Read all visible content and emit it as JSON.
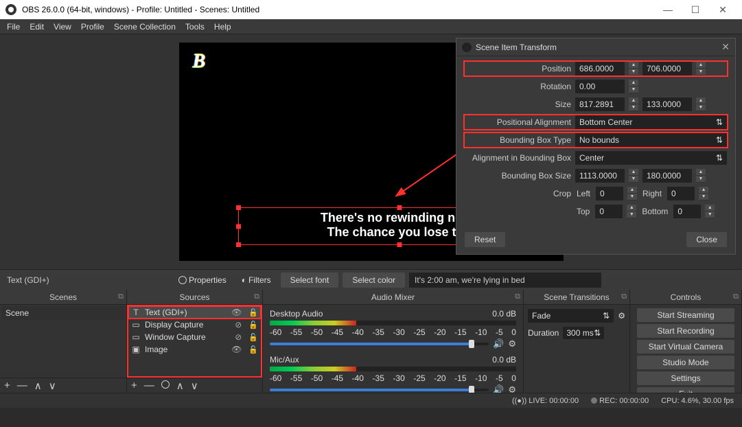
{
  "window": {
    "title": "OBS 26.0.0 (64-bit, windows) - Profile: Untitled - Scenes: Untitled"
  },
  "menu": {
    "file": "File",
    "edit": "Edit",
    "view": "View",
    "profile": "Profile",
    "scene_collection": "Scene Collection",
    "tools": "Tools",
    "help": "Help"
  },
  "dialog": {
    "title": "Scene Item Transform",
    "labels": {
      "position": "Position",
      "rotation": "Rotation",
      "size": "Size",
      "pos_align": "Positional Alignment",
      "bbox_type": "Bounding Box Type",
      "align_bbox": "Alignment in Bounding Box",
      "bbox_size": "Bounding Box Size",
      "crop": "Crop",
      "left": "Left",
      "right": "Right",
      "top": "Top",
      "bottom": "Bottom"
    },
    "position_x": "686.0000",
    "position_y": "706.0000",
    "rotation": "0.00",
    "size_w": "817.2891",
    "size_h": "133.0000",
    "pos_align": "Bottom Center",
    "bbox_type": "No bounds",
    "align_bbox": "Center",
    "bbox_w": "1113.0000",
    "bbox_h": "180.0000",
    "crop_left": "0",
    "crop_right": "0",
    "crop_top": "0",
    "crop_bottom": "0",
    "reset": "Reset",
    "close": "Close"
  },
  "preview": {
    "logo": "B",
    "subtitle1": "There's no rewinding no re",
    "subtitle2": "The chance you lose too"
  },
  "toolbar": {
    "source_label": "Text (GDI+)",
    "properties": "Properties",
    "filters": "Filters",
    "select_font": "Select font",
    "select_color": "Select color",
    "text_value": "It's 2:00 am, we're lying in bed"
  },
  "panels": {
    "scenes": "Scenes",
    "sources": "Sources",
    "mixer": "Audio Mixer",
    "transitions": "Scene Transitions",
    "controls": "Controls"
  },
  "scenes": {
    "item": "Scene"
  },
  "sources": {
    "items": [
      {
        "icon": "T",
        "label": "Text (GDI+)",
        "selected": true,
        "visible": true
      },
      {
        "icon": "▭",
        "label": "Display Capture",
        "selected": false,
        "visible": false
      },
      {
        "icon": "▭",
        "label": "Window Capture",
        "selected": false,
        "visible": false
      },
      {
        "icon": "▣",
        "label": "Image",
        "selected": false,
        "visible": true
      }
    ]
  },
  "mixer": {
    "desktop": "Desktop Audio",
    "mic": "Mic/Aux",
    "db": "0.0 dB",
    "ticks": [
      "-60",
      "-55",
      "-50",
      "-45",
      "-40",
      "-35",
      "-30",
      "-25",
      "-20",
      "-15",
      "-10",
      "-5",
      "0"
    ]
  },
  "transitions": {
    "value": "Fade",
    "duration_label": "Duration",
    "duration": "300 ms"
  },
  "controls": {
    "stream": "Start Streaming",
    "record": "Start Recording",
    "vcam": "Start Virtual Camera",
    "studio": "Studio Mode",
    "settings": "Settings",
    "exit": "Exit"
  },
  "status": {
    "live": "LIVE: 00:00:00",
    "rec": "REC: 00:00:00",
    "cpu": "CPU: 4.6%, 30.00 fps"
  }
}
